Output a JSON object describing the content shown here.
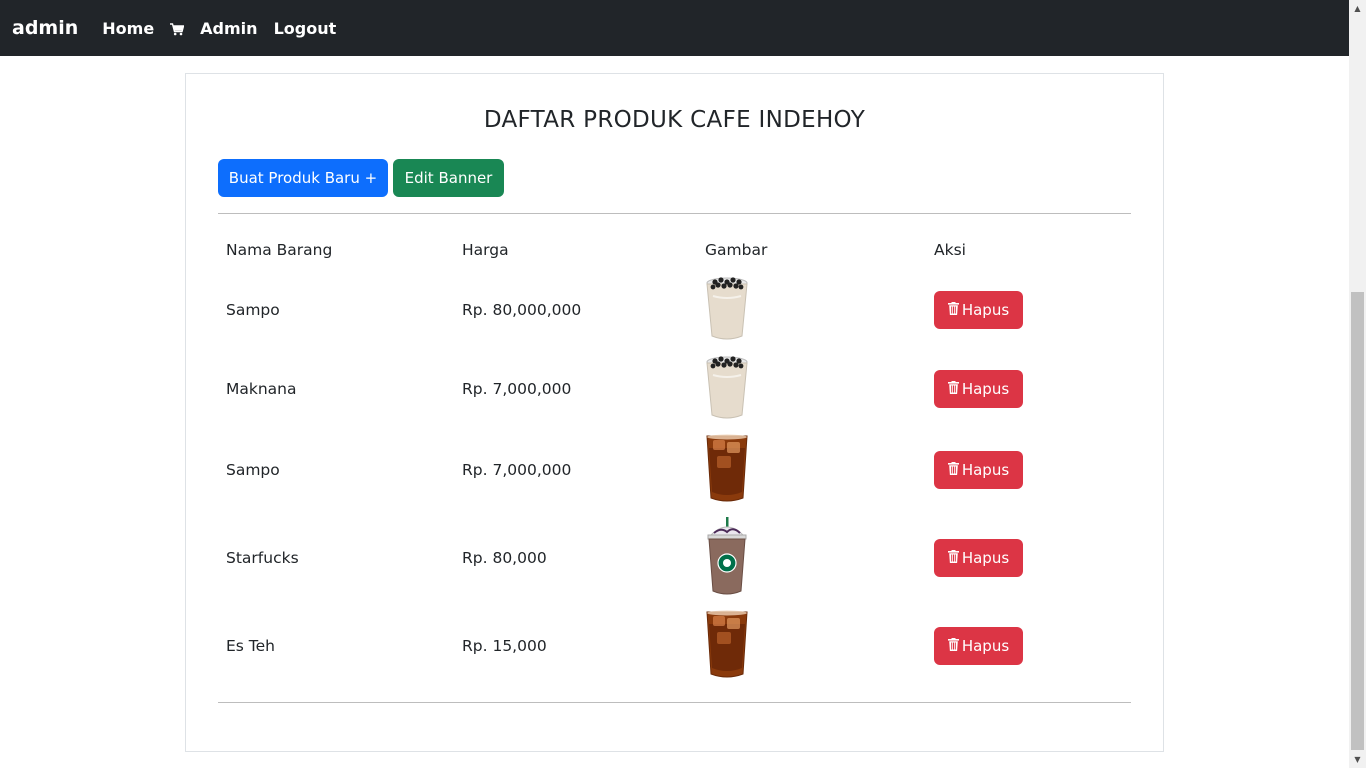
{
  "nav": {
    "brand": "admin",
    "links": [
      "Home",
      "Admin",
      "Logout"
    ],
    "cart_icon": "cart-icon",
    "bg_color": "#212529"
  },
  "page": {
    "title": "DAFTAR PRODUK CAFE INDEHOY",
    "buttons": {
      "new_product": "Buat Produk Baru +",
      "edit_banner": "Edit Banner"
    }
  },
  "table": {
    "headers": [
      "Nama Barang",
      "Harga",
      "Gambar",
      "Aksi"
    ],
    "rows": [
      {
        "name": "Sampo",
        "price": "Rp. 80,000,000",
        "image": "bubble-tea",
        "action": "Hapus"
      },
      {
        "name": "Maknana",
        "price": "Rp. 7,000,000",
        "image": "bubble-tea",
        "action": "Hapus"
      },
      {
        "name": "Sampo",
        "price": "Rp. 7,000,000",
        "image": "iced-tea",
        "action": "Hapus"
      },
      {
        "name": "Starfucks",
        "price": "Rp. 80,000",
        "image": "frappuccino",
        "action": "Hapus"
      },
      {
        "name": "Es Teh",
        "price": "Rp. 15,000",
        "image": "iced-tea",
        "action": "Hapus"
      }
    ]
  },
  "colors": {
    "primary": "#0d6efd",
    "success": "#198754",
    "danger": "#dc3545"
  }
}
